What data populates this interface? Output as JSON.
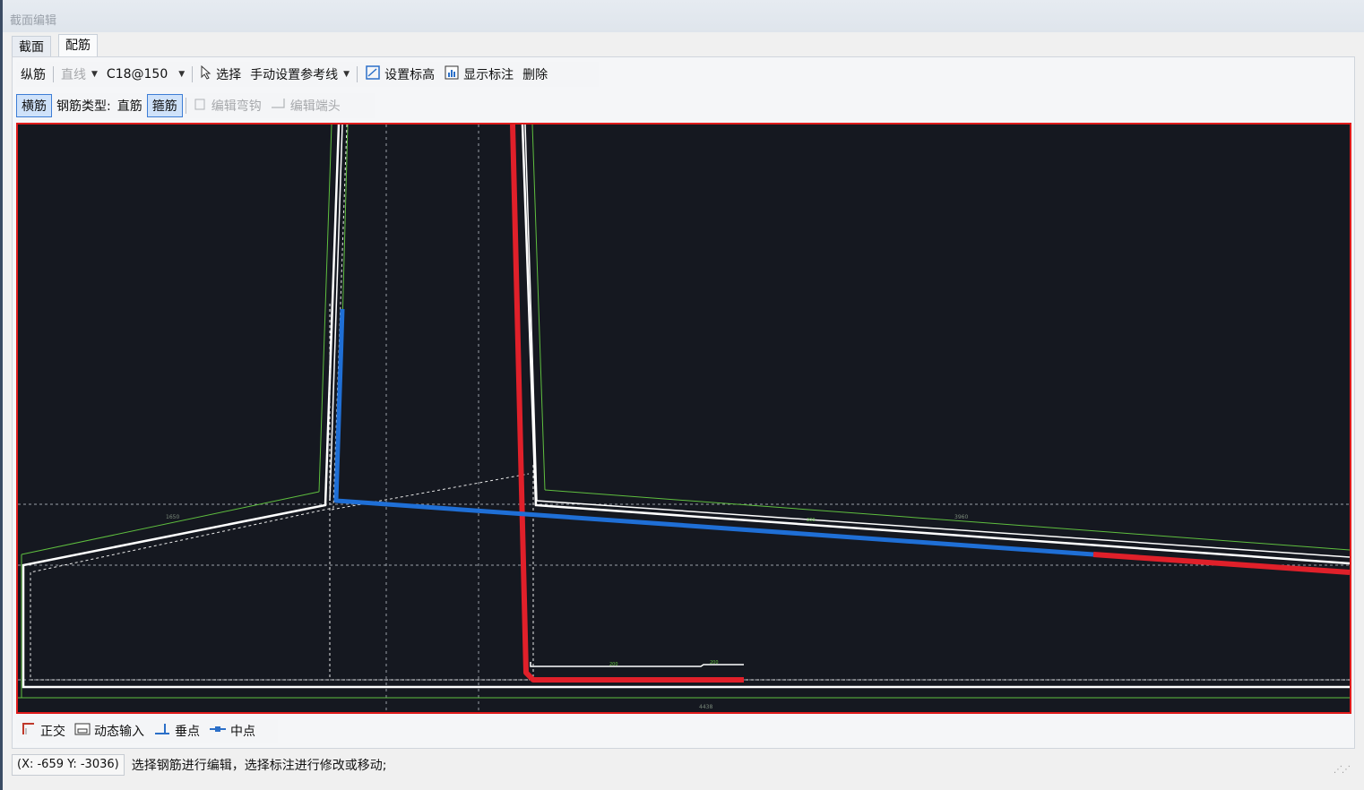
{
  "window": {
    "title": "截面编辑"
  },
  "tabs": [
    {
      "label": "截面"
    },
    {
      "label": "配筋"
    }
  ],
  "toolbar1": {
    "longitudinal": "纵筋",
    "line_mode": "直线",
    "spec": "C18@150",
    "select": "选择",
    "manual_ref": "手动设置参考线",
    "set_elevation": "设置标高",
    "show_dims": "显示标注",
    "delete": "删除"
  },
  "toolbar2": {
    "transverse": "横筋",
    "rebar_type_label": "钢筋类型:",
    "straight": "直筋",
    "stirrup": "箍筋",
    "edit_hook": "编辑弯钩",
    "edit_end": "编辑端头"
  },
  "canvas": {
    "dim_left": "1650",
    "dim_right": "3960",
    "dim_bottom": "4438",
    "dim_small1": "200",
    "dim_small2": "200",
    "dim_small3": "200"
  },
  "snap": {
    "ortho": "正交",
    "dynamic_input": "动态输入",
    "perpendicular": "垂点",
    "midpoint": "中点"
  },
  "status": {
    "coords": "(X: -659 Y: -3036)",
    "message": "选择钢筋进行编辑，选择标注进行修改或移动;"
  },
  "colors": {
    "canvas_bg": "#151820",
    "selected_rebar": "#e0202a",
    "highlight_rebar": "#1f6fd6",
    "outline": "#ffffff",
    "guide": "#5fbf3f",
    "active_border": "#3d7dd6"
  }
}
